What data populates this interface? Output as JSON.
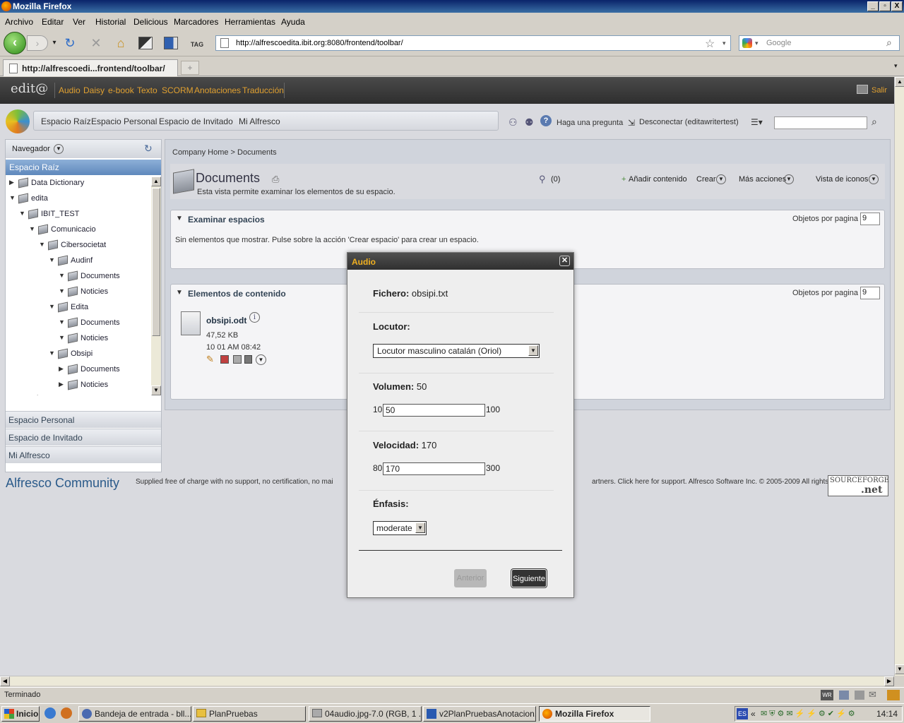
{
  "window": {
    "title": "Mozilla Firefox",
    "controls": [
      "_",
      "▫",
      "X"
    ]
  },
  "menu": [
    "Archivo",
    "Editar",
    "Ver",
    "Historial",
    "Delicious",
    "Marcadores",
    "Herramientas",
    "Ayuda"
  ],
  "nav": {
    "url": "http://alfrescoedita.ibit.org:8080/frontend/toolbar/",
    "search_placeholder": "Google",
    "tag_label": "TAG"
  },
  "tab": {
    "title": "http://alfrescoedi...frontend/toolbar/",
    "new_tab": "+"
  },
  "edita": {
    "logo": "edit@",
    "items": [
      "Audio",
      "Daisy",
      "e-book",
      "Texto",
      "SCORM",
      "Anotaciones",
      "Traducción"
    ],
    "salir": "Salir"
  },
  "alfresco": {
    "spaces": [
      "Espacio Raíz",
      "Espacio Personal",
      "Espacio de Invitado",
      "Mi Alfresco"
    ],
    "help": "Haga una pregunta",
    "logout": "Desconectar (editawritertest)"
  },
  "sidebar": {
    "navigator": "Navegador",
    "selected": "Espacio Raíz",
    "tree": [
      {
        "label": "Data Dictionary",
        "level": 0,
        "open": false
      },
      {
        "label": "edita",
        "level": 0,
        "open": true
      },
      {
        "label": "IBIT_TEST",
        "level": 1,
        "open": true
      },
      {
        "label": "Comunicacio",
        "level": 2,
        "open": true
      },
      {
        "label": "Cibersocietat",
        "level": 3,
        "open": true
      },
      {
        "label": "Audinf",
        "level": 4,
        "open": true
      },
      {
        "label": "Documents",
        "level": 5,
        "open": true
      },
      {
        "label": "Noticies",
        "level": 5,
        "open": true
      },
      {
        "label": "Edita",
        "level": 4,
        "open": true
      },
      {
        "label": "Documents",
        "level": 5,
        "open": true
      },
      {
        "label": "Noticies",
        "level": 5,
        "open": true
      },
      {
        "label": "Obsipi",
        "level": 4,
        "open": true
      },
      {
        "label": "Documents",
        "level": 5,
        "open": false
      },
      {
        "label": "Noticies",
        "level": 5,
        "open": false
      },
      {
        "label": "temp",
        "level": 1,
        "open": false
      }
    ],
    "sections": [
      "Espacio Personal",
      "Espacio de Invitado",
      "Mi Alfresco"
    ]
  },
  "main": {
    "breadcrumb": [
      "Company Home",
      ">",
      "Documents"
    ],
    "title": "Documents",
    "description": "Esta vista permite examinar los elementos de su espacio.",
    "count": "(0)",
    "actions": [
      "Añadir contenido",
      "Crear",
      "Más acciones",
      "Vista de iconos"
    ],
    "spaces_box": {
      "title": "Examinar espacios",
      "per_page_label": "Objetos por pagina",
      "per_page": "9",
      "empty": "Sin elementos que mostrar. Pulse sobre la acción 'Crear espacio' para crear un espacio."
    },
    "content_box": {
      "title": "Elementos de contenido",
      "per_page_label": "Objetos por pagina",
      "per_page": "9"
    },
    "file": {
      "name": "obsipi.odt",
      "size": "47,52 KB",
      "date": "10 01 AM 08:42"
    }
  },
  "footer": {
    "logo": "Alfresco Community",
    "text": "Supplied free of charge with no support, no certification, no mai",
    "text2": "artners. Click here for support. Alfresco Software Inc. © 2005-2009 All rights",
    "sf_top": "SOURCEFORGE",
    "sf_bottom": ".net"
  },
  "dialog": {
    "title": "Audio",
    "close": "✕",
    "fichero_label": "Fichero:",
    "fichero_value": "obsipi.txt",
    "locutor_label": "Locutor:",
    "locutor_value": "Locutor masculino catalán (Oriol)",
    "volumen_label": "Volumen:",
    "volumen_value": "50",
    "volumen_min": "10",
    "volumen_max": "100",
    "velocidad_label": "Velocidad:",
    "velocidad_value": "170",
    "velocidad_min": "80",
    "velocidad_max": "300",
    "enfasis_label": "Énfasis:",
    "enfasis_value": "moderate",
    "prev": "Anterior",
    "next": "Siguiente"
  },
  "status": "Terminado",
  "taskbar": {
    "start": "Inicio",
    "items": [
      "Bandeja de entrada - bll...",
      "PlanPruebas",
      "04audio.jpg-7.0 (RGB, 1 ...",
      "v2PlanPruebasAnotacion...",
      "Mozilla Firefox"
    ],
    "clock": "14:14",
    "lang": "ES"
  }
}
